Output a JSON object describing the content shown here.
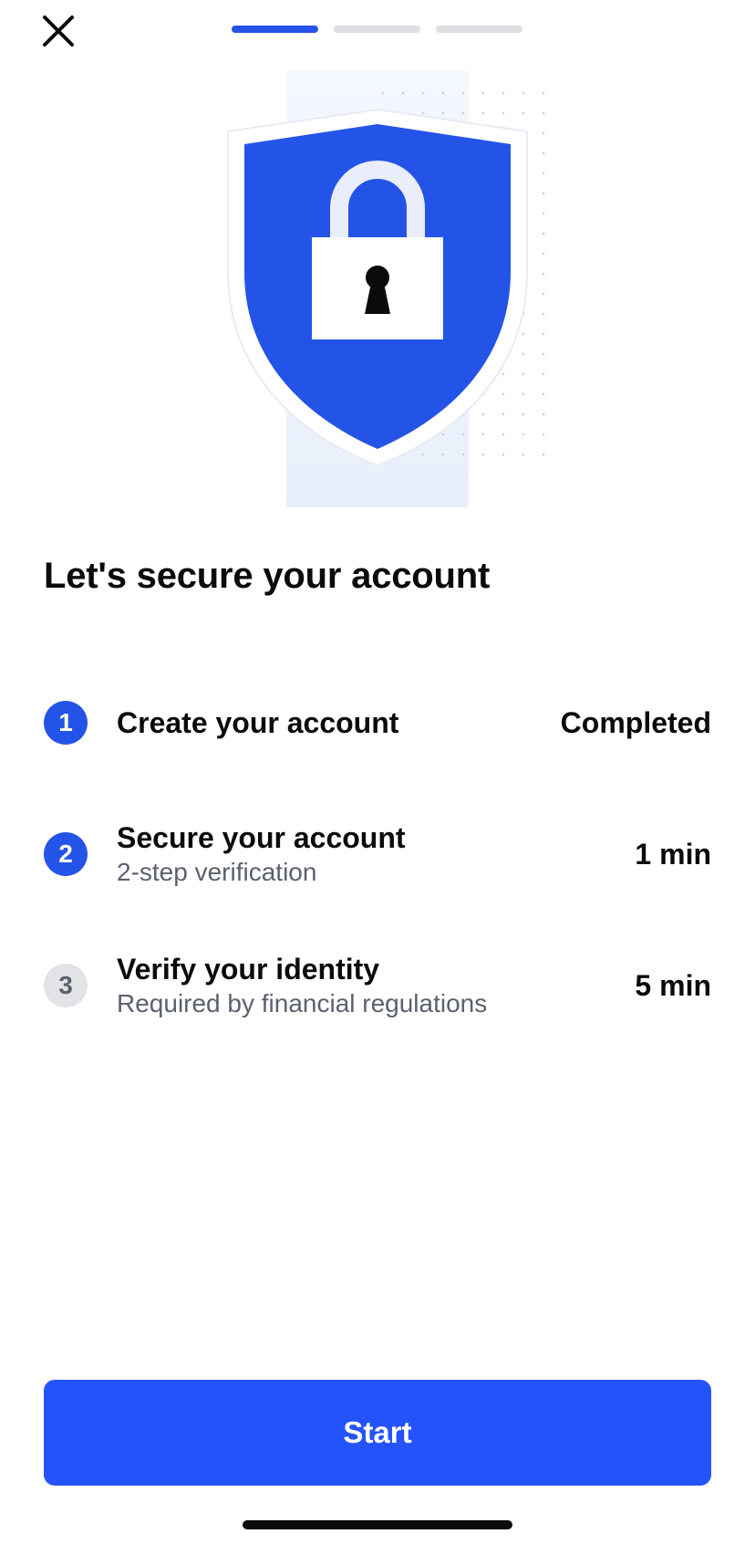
{
  "header": {
    "close_icon": "close-icon",
    "progress": {
      "current_step": 1,
      "total_steps": 3
    }
  },
  "hero": {
    "illustration_icon": "shield-lock-icon",
    "colors": {
      "shield": "#2453e8",
      "panel": "#eef3fc",
      "lock": "#ffffff"
    }
  },
  "title": "Let's secure your account",
  "steps": [
    {
      "number": "1",
      "name": "Create your account",
      "subtitle": "",
      "right": "Completed",
      "state": "done"
    },
    {
      "number": "2",
      "name": "Secure your account",
      "subtitle": "2-step verification",
      "right": "1 min",
      "state": "current"
    },
    {
      "number": "3",
      "name": "Verify your identity",
      "subtitle": "Required by financial regulations",
      "right": "5 min",
      "state": "upcoming"
    }
  ],
  "start_button": {
    "label": "Start"
  },
  "colors": {
    "accent": "#2453e8",
    "inactive": "#e2e3e6",
    "muted_text": "#5b616e"
  }
}
